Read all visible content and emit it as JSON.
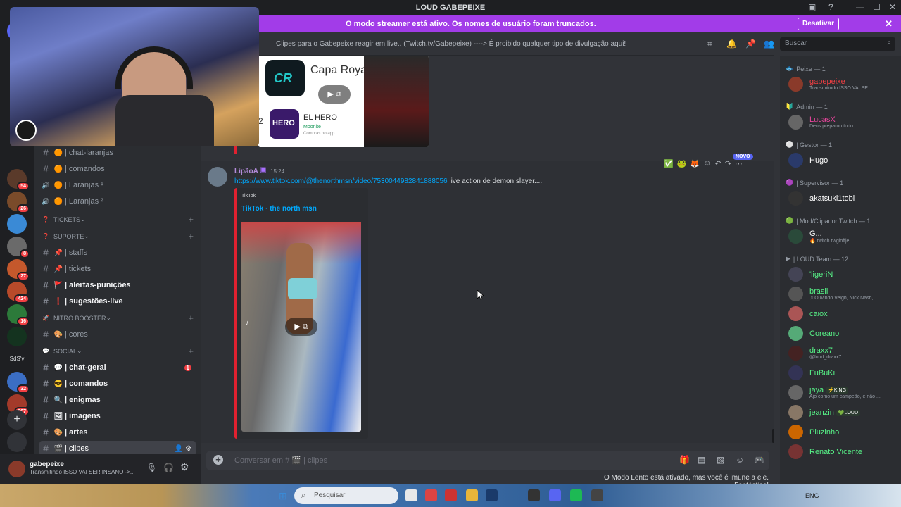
{
  "window": {
    "title": "LOUD GABEPEIXE",
    "controls": [
      "—",
      "☐",
      "✕"
    ]
  },
  "streamer_banner": {
    "message": "O modo streamer está ativo. Os nomes de usuário foram truncados.",
    "button": "Desativar",
    "close": "✕"
  },
  "channel_header": {
    "topic": "Clipes para o Gabepeixe reagir em live.. (Twitch.tv/Gabepeixe) ----> É proibido qualquer tipo de divulgação aqui!",
    "search_placeholder": "Buscar"
  },
  "servers": [
    {
      "badge": "54",
      "color": "#5a3a2a"
    },
    {
      "badge": "26",
      "color": "#7a4b2a"
    },
    {
      "badge": "",
      "color": "#3a8ad6"
    },
    {
      "badge": "8",
      "color": "#6a6a6a"
    },
    {
      "badge": "27",
      "color": "#c4582c"
    },
    {
      "badge": "424",
      "color": "#b84a2a"
    },
    {
      "badge": "16",
      "color": "#2c7a3a"
    },
    {
      "badge": "",
      "color": "#14331f"
    },
    {
      "badge": "",
      "color": "#1e1f22",
      "label": "SdS'v"
    },
    {
      "badge": "32",
      "color": "#3b6ec4"
    },
    {
      "badge": "807",
      "color": "#a33a2a"
    }
  ],
  "channels": {
    "top_items": [
      {
        "name": "| chat-laranjas",
        "emoji": "🟠"
      },
      {
        "name": "| comandos",
        "emoji": "🟠"
      },
      {
        "name": "| Laranjas ¹",
        "emoji": "🟠",
        "voice": true
      },
      {
        "name": "| Laranjas ²",
        "emoji": "🟠",
        "voice": true
      }
    ],
    "categories": [
      {
        "name": "TICKETS",
        "emoji": "❓"
      },
      {
        "name": "SUPORTE",
        "emoji": "❓",
        "items": [
          {
            "name": "| staffs",
            "emoji": "📌"
          },
          {
            "name": "| tickets",
            "emoji": "📌"
          },
          {
            "name": "| alertas-punições",
            "emoji": "🚩",
            "bold": true
          },
          {
            "name": "| sugestões-live",
            "emoji": "❗",
            "bold": true
          }
        ]
      },
      {
        "name": "NITRO BOOSTER",
        "emoji": "🚀",
        "items": [
          {
            "name": "| cores",
            "emoji": "🎨"
          }
        ]
      },
      {
        "name": "SOCIAL",
        "emoji": "💬",
        "items": [
          {
            "name": "| chat-geral",
            "emoji": "💬",
            "bold": true,
            "mention": "1"
          },
          {
            "name": "| comandos",
            "emoji": "😎",
            "bold": true
          },
          {
            "name": "| enigmas",
            "emoji": "🔍",
            "bold": true
          },
          {
            "name": "| imagens",
            "emoji": "🖼",
            "bold": true
          },
          {
            "name": "| artes",
            "emoji": "🎨",
            "bold": true
          },
          {
            "name": "| clipes",
            "emoji": "🎬",
            "active": true
          }
        ]
      }
    ]
  },
  "user_panel": {
    "name": "gabepeixe",
    "status": "Transmitindo ISSO VAI SER INSANO ->..."
  },
  "messages": {
    "prev_embed": {
      "title1": "Capa Royale",
      "title2": "EL HERO",
      "sub2": "Moonite",
      "sub2b": "Compras no app",
      "num": "2"
    },
    "message": {
      "author": "LipãoA",
      "time": "15:24",
      "link": "https://www.tiktok.com/@thenorthmsn/video/7530044982841888056",
      "text": " live action de demon slayer....",
      "embed_provider": "TikTok",
      "embed_title": "TikTok · the north msn",
      "new_badge": "NOVO"
    }
  },
  "composer": {
    "placeholder": "Conversar em # 🎬 | clipes"
  },
  "slowmode_text": "O Modo Lento está ativado, mas você é imune a ele. Fantástico!",
  "members": {
    "sections": [
      {
        "role": "Peixe — 1",
        "icon": "🐟",
        "people": [
          {
            "name": "gabepeixe",
            "sub": "Transmitindo ISSO VAI SE...",
            "color": "#f23f43",
            "av": "#8a3a2a"
          }
        ]
      },
      {
        "role": "Admin — 1",
        "icon": "🔰",
        "people": [
          {
            "name": "LucasX",
            "sub": "Deus preparou tudo.",
            "color": "#eb459e",
            "av": "#666"
          }
        ]
      },
      {
        "role": "| Gestor — 1",
        "icon": "⚪",
        "people": [
          {
            "name": "Hugo",
            "sub": "",
            "color": "#ffffff",
            "av": "#2a3a6a"
          }
        ]
      },
      {
        "role": "| Supervisor — 1",
        "icon": "🟣",
        "people": [
          {
            "name": "akatsuki1tobi",
            "sub": "",
            "color": "#ffffff",
            "av": "#333"
          }
        ]
      },
      {
        "role": "| Mod/Clipador Twitch — 1",
        "icon": "🟢",
        "people": [
          {
            "name": "G...",
            "sub": "🔥 twitch.tv/gloffje",
            "color": "#ffffff",
            "av": "#2a4a3a"
          }
        ]
      },
      {
        "role": "| LOUD Team — 12",
        "icon": "▶",
        "people": [
          {
            "name": "'ligeriN",
            "sub": "",
            "color": "#57f287",
            "av": "#445"
          },
          {
            "name": "brasil",
            "sub": "♫ Ouvindo Veigh, Nick Nash, ...",
            "color": "#57f287",
            "av": "#555"
          },
          {
            "name": "caiox",
            "sub": "",
            "color": "#57f287",
            "av": "#a55"
          },
          {
            "name": "Coreano",
            "sub": "",
            "color": "#57f287",
            "av": "#5a7"
          },
          {
            "name": "draxx7",
            "sub": "@loud_draxx7",
            "color": "#57f287",
            "av": "#422"
          },
          {
            "name": "FuBuKi",
            "sub": "",
            "color": "#57f287",
            "av": "#335"
          },
          {
            "name": "jaya",
            "sub": "Ajo como um campeão, e não ...",
            "color": "#57f287",
            "av": "#666",
            "tag": "⚡KING"
          },
          {
            "name": "jeanzin",
            "sub": "",
            "color": "#57f287",
            "av": "#876",
            "tag": "💚LOUD"
          },
          {
            "name": "Piuzinho",
            "sub": "",
            "color": "#57f287",
            "av": "#c60"
          },
          {
            "name": "Renato Vicente",
            "sub": "",
            "color": "#57f287",
            "av": "#733"
          }
        ]
      }
    ]
  },
  "taskbar": {
    "search": "Pesquisar",
    "lang": "ENG"
  }
}
